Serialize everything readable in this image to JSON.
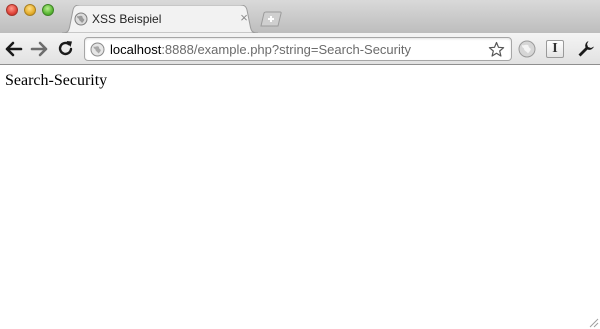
{
  "browser": {
    "tab": {
      "title": "XSS Beispiel",
      "close_icon": "×",
      "favicon": "globe-icon"
    },
    "new_tab_icon": "plus-icon",
    "toolbar": {
      "back_icon": "back-arrow-icon",
      "forward_icon": "forward-arrow-icon",
      "reload_icon": "reload-icon"
    },
    "address_bar": {
      "host": "localhost",
      "rest": ":8888/example.php?string=Search-Security",
      "bookmark_icon": "star-icon"
    },
    "extensions": {
      "globe_icon": "globe-icon",
      "i_label": "I",
      "wrench_icon": "wrench-icon"
    }
  },
  "page": {
    "body_text": "Search-Security"
  },
  "colors": {
    "url_host": "#000000",
    "url_rest": "#6b6b6b",
    "tabstrip": "#c9c9c9",
    "toolbar": "#ebebeb"
  }
}
